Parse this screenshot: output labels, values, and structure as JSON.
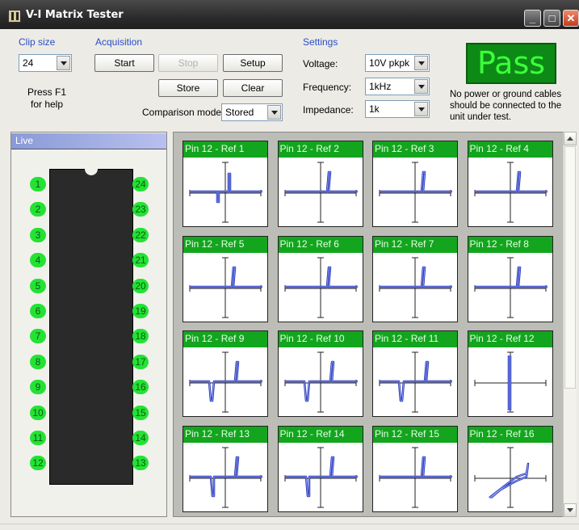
{
  "window": {
    "title": "V-I Matrix Tester"
  },
  "clip_size": {
    "group_label": "Clip size",
    "value": "24",
    "help": "Press F1 for help"
  },
  "acquisition": {
    "group_label": "Acquisition",
    "start_label": "Start",
    "stop_label": "Stop",
    "setup_label": "Setup",
    "store_label": "Store",
    "clear_label": "Clear",
    "comparison_label": "Comparison mode",
    "comparison_value": "Stored"
  },
  "settings": {
    "group_label": "Settings",
    "voltage_label": "Voltage:",
    "voltage_value": "10V pkpk",
    "frequency_label": "Frequency:",
    "frequency_value": "1kHz",
    "impedance_label": "Impedance:",
    "impedance_value": "1k"
  },
  "result": {
    "status": "Pass",
    "note": "No power or ground cables should be connected to the unit under test.",
    "color": "#3cff3c"
  },
  "live": {
    "label": "Live"
  },
  "pins_left": [
    "1",
    "2",
    "3",
    "4",
    "5",
    "6",
    "7",
    "8",
    "9",
    "10",
    "11",
    "12"
  ],
  "pins_right": [
    "24",
    "23",
    "22",
    "21",
    "20",
    "19",
    "18",
    "17",
    "16",
    "15",
    "14",
    "13"
  ],
  "cells": [
    {
      "label": "Pin 12 - Ref 1",
      "curve": "a"
    },
    {
      "label": "Pin 12 - Ref 2",
      "curve": "b"
    },
    {
      "label": "Pin 12 - Ref 3",
      "curve": "b"
    },
    {
      "label": "Pin 12 - Ref 4",
      "curve": "b"
    },
    {
      "label": "Pin 12 - Ref 5",
      "curve": "b"
    },
    {
      "label": "Pin 12 - Ref 6",
      "curve": "b"
    },
    {
      "label": "Pin 12 - Ref 7",
      "curve": "b"
    },
    {
      "label": "Pin 12 - Ref 8",
      "curve": "b"
    },
    {
      "label": "Pin 12 - Ref 9",
      "curve": "c"
    },
    {
      "label": "Pin 12 - Ref 10",
      "curve": "c"
    },
    {
      "label": "Pin 12 - Ref 11",
      "curve": "c"
    },
    {
      "label": "Pin 12 - Ref 12",
      "curve": "d"
    },
    {
      "label": "Pin 12 - Ref 13",
      "curve": "e"
    },
    {
      "label": "Pin 12 - Ref 14",
      "curve": "e"
    },
    {
      "label": "Pin 12 - Ref 15",
      "curve": "b"
    },
    {
      "label": "Pin 12 - Ref 16",
      "curve": "f"
    }
  ],
  "icons": {
    "app": "vi-tester-icon",
    "minimize": "minimize-icon",
    "maximize": "maximize-icon",
    "close": "close-icon"
  }
}
